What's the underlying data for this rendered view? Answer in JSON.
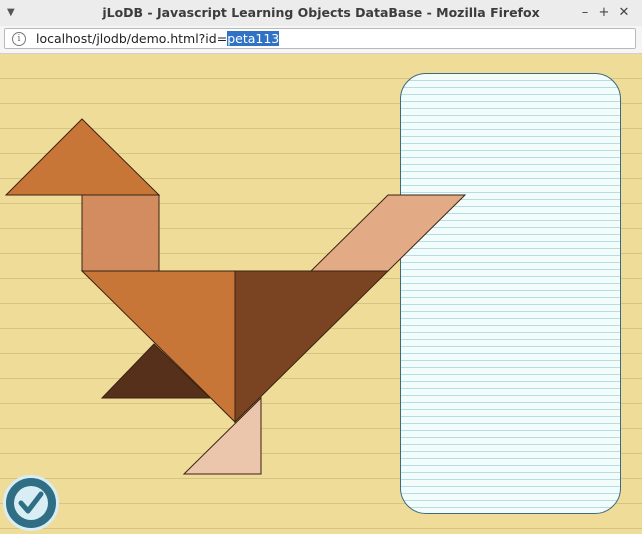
{
  "window": {
    "title": "jLoDB - Javascript Learning Objects DataBase - Mozilla Firefox",
    "menu_icon": "chevron-down-icon",
    "minimize_label": "–",
    "maximize_label": "+",
    "close_label": "✕"
  },
  "address": {
    "info_icon": "info-icon",
    "url_prefix": "localhost/jlodb/demo.html?id=",
    "url_selected": "peta113"
  },
  "content": {
    "check_icon": "checkmark-icon",
    "colors": {
      "background": "#eedc98",
      "paper": "#f2fdfb",
      "piece_head_triangle": "#c87538",
      "piece_square": "#d38c60",
      "piece_large_triangle_light": "#c87538",
      "piece_large_triangle_dark": "#7a4422",
      "piece_small_dark_triangle": "#56301a",
      "piece_parallelogram": "#e3aa86",
      "piece_small_pale_triangle": "#ebc6ac",
      "check_button": "#2f6e85"
    }
  }
}
